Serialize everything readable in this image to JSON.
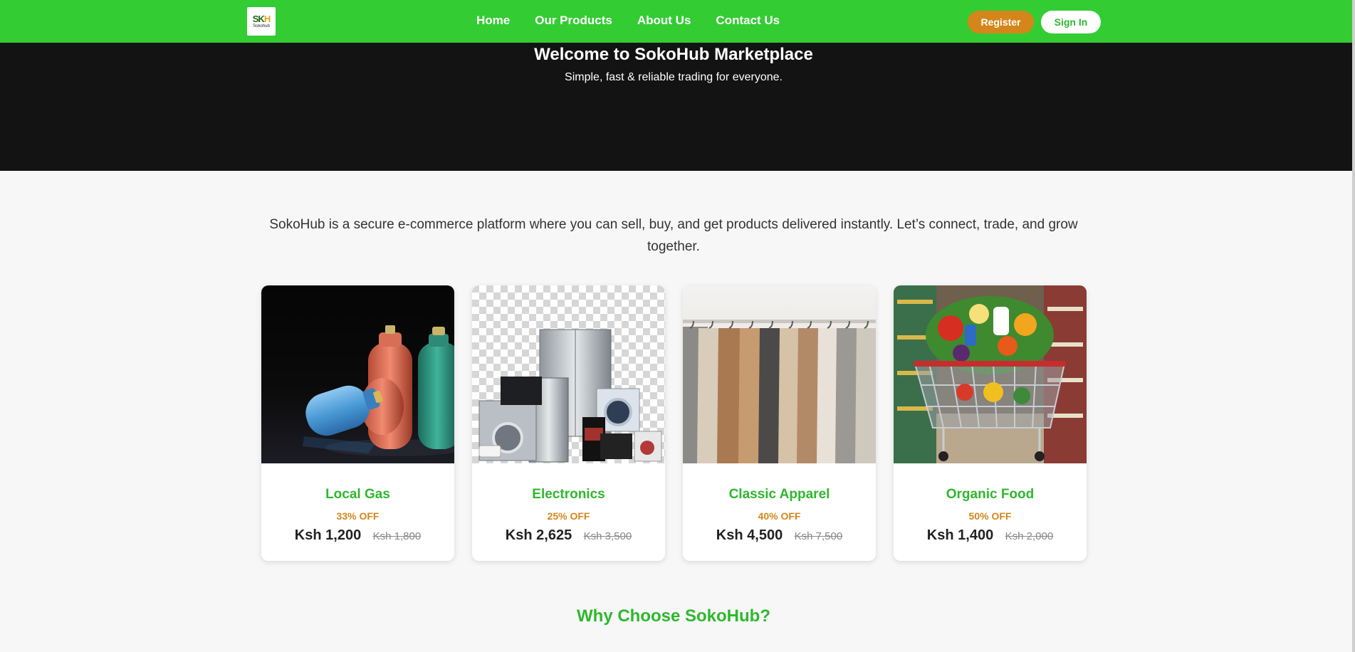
{
  "brand": {
    "logo_text": "Sokohub",
    "logo_mark_a": "SK",
    "logo_mark_b": "H"
  },
  "nav": {
    "links": [
      {
        "label": "Home"
      },
      {
        "label": "Our Products"
      },
      {
        "label": "About Us"
      },
      {
        "label": "Contact Us"
      }
    ],
    "register_label": "Register",
    "signin_label": "Sign In"
  },
  "hero": {
    "title": "Welcome to SokoHub Marketplace",
    "subtitle": "Simple, fast & reliable trading for everyone."
  },
  "intro": "SokoHub is a secure e-commerce platform where you can sell, buy, and get products delivered instantly. Let’s connect, trade, and grow together.",
  "products": [
    {
      "title": "Local Gas",
      "discount": "33% OFF",
      "price": "Ksh 1,200",
      "old_price": "Ksh 1,800",
      "image": "gas-cylinders-image"
    },
    {
      "title": "Electronics",
      "discount": "25% OFF",
      "price": "Ksh 2,625",
      "old_price": "Ksh 3,500",
      "image": "home-appliances-image"
    },
    {
      "title": "Classic Apparel",
      "discount": "40% OFF",
      "price": "Ksh 4,500",
      "old_price": "Ksh 7,500",
      "image": "clothing-rack-image"
    },
    {
      "title": "Organic Food",
      "discount": "50% OFF",
      "price": "Ksh 1,400",
      "old_price": "Ksh 2,000",
      "image": "grocery-cart-image"
    }
  ],
  "why_title": "Why Choose SokoHub?",
  "colors": {
    "primary_green": "#33cc33",
    "accent_orange": "#d4861a",
    "hero_bg": "#131313",
    "page_bg": "#f7f7f7"
  }
}
